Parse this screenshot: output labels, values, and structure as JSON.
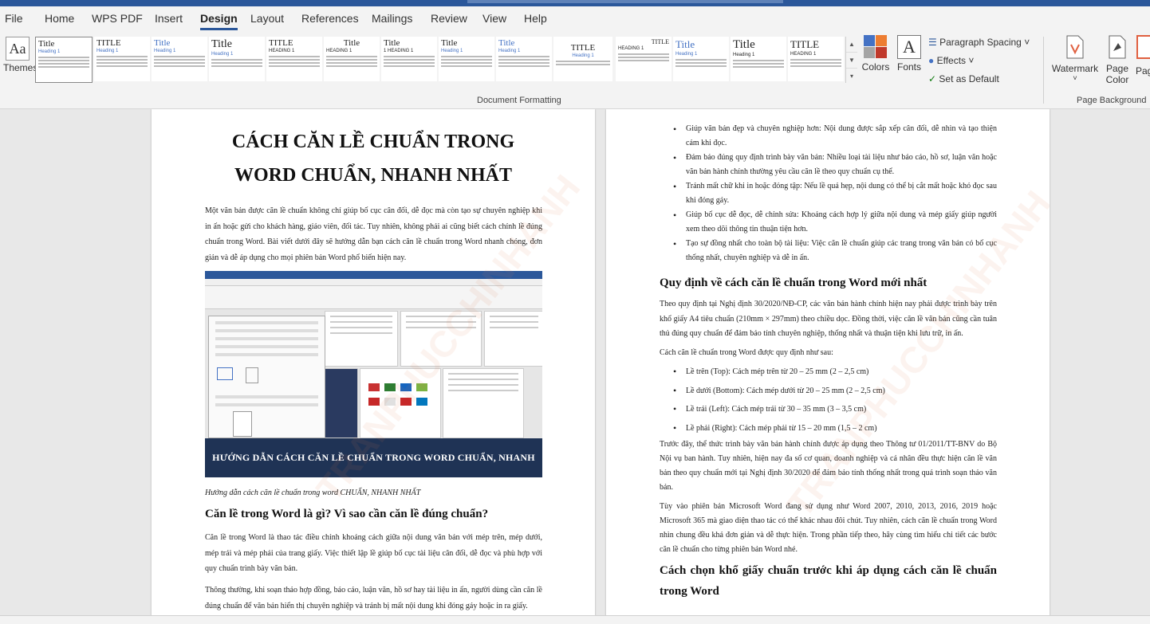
{
  "ribbon_tabs": [
    "File",
    "Home",
    "WPS PDF",
    "Insert",
    "Design",
    "Layout",
    "References",
    "Mailings",
    "Review",
    "View",
    "Help"
  ],
  "active_tab": "Design",
  "themes_label": "Themes",
  "style_gallery": [
    {
      "title": "Title",
      "heading": "Heading 1"
    },
    {
      "title": "TITLE",
      "heading": "Heading 1"
    },
    {
      "title": "Title",
      "heading": "Heading 1"
    },
    {
      "title": "Title",
      "heading": "Heading 1"
    },
    {
      "title": "TITLE",
      "heading": "HEADING 1"
    },
    {
      "title": "Title",
      "heading": "HEADING 1"
    },
    {
      "title": "Title",
      "heading": "1 HEADING 1"
    },
    {
      "title": "Title",
      "heading": "Heading 1"
    },
    {
      "title": "Title",
      "heading": "Heading 1"
    },
    {
      "title": "TITLE",
      "heading": "Heading 1"
    },
    {
      "title": "TITLE",
      "heading": "HEADING 1"
    },
    {
      "title": "Title",
      "heading": "Heading 1"
    },
    {
      "title": "Title",
      "heading": "Heading 1"
    },
    {
      "title": "TITLE",
      "heading": "HEADING 1"
    }
  ],
  "colors_label": "Colors",
  "fonts_label": "Fonts",
  "paragraph_spacing_label": "Paragraph Spacing",
  "effects_label": "Effects",
  "set_default_label": "Set as Default",
  "watermark_label": "Watermark",
  "page_color_label": "Page Color",
  "page_borders_label": "Page Bo",
  "document_formatting_label": "Document Formatting",
  "page_background_label": "Page Background",
  "page1": {
    "title_line1": "CÁCH CĂN LỀ CHUẨN TRONG",
    "title_line2": "WORD CHUẨN, NHANH NHẤT",
    "intro": "Một văn bản được căn lề chuẩn không chỉ giúp bố cục cân đối, dễ đọc mà còn tạo sự chuyên nghiệp khi in ấn hoặc gửi cho khách hàng, giáo viên, đối tác. Tuy nhiên, không phải ai cũng biết cách chỉnh lề đúng chuẩn trong Word. Bài viết dưới đây sẽ hướng dẫn bạn cách căn lề chuẩn trong Word nhanh chóng, đơn giản và dễ áp dụng cho mọi phiên bản Word phổ biến hiện nay.",
    "image_banner": "HƯỚNG DẪN CÁCH CĂN LỀ CHUẨN TRONG WORD CHUẨN, NHANH NHẤT",
    "caption": "Hướng dẫn cách căn lề chuẩn trong word CHUẨN, NHANH NHẤT",
    "heading2": "Căn lề trong Word là gì? Vì sao cần căn lề đúng chuẩn?",
    "para2": "Căn lề trong Word là thao tác điều chỉnh khoảng cách giữa nội dung văn bản với mép trên, mép dưới, mép trái và mép phải của trang giấy. Việc thiết lập lề giúp bố cục tài liệu cân đối, dễ đọc và phù hợp với quy chuẩn trình bày văn bản.",
    "para3": "Thông thường, khi soạn thảo hợp đồng, báo cáo, luận văn, hồ sơ hay tài liệu in ấn, người dùng cần căn lề đúng chuẩn để văn bản hiển thị chuyên nghiệp và tránh bị mất nội dung khi đóng gáy hoặc in ra giấy."
  },
  "page2": {
    "bullets1": [
      "Giúp văn bản đẹp và chuyên nghiệp hơn: Nội dung được sắp xếp cân đối, dễ nhìn và tạo thiện cảm khi đọc.",
      "Đảm bảo đúng quy định trình bày văn bản: Nhiều loại tài liệu như báo cáo, hồ sơ, luận văn hoặc văn bản hành chính thường yêu cầu căn lề theo quy chuẩn cụ thể.",
      "Tránh mất chữ khi in hoặc đóng tập: Nếu lề quá hẹp, nội dung có thể bị cắt mất hoặc khó đọc sau khi đóng gáy.",
      "Giúp bố cục dễ đọc, dễ chỉnh sửa: Khoảng cách hợp lý giữa nội dung và mép giấy giúp người xem theo dõi thông tin thuận tiện hơn.",
      "Tạo sự đồng nhất cho toàn bộ tài liệu: Việc căn lề chuẩn giúp các trang trong văn bản có bố cục thống nhất, chuyên nghiệp và dễ in ấn."
    ],
    "heading1": "Quy định về cách căn lề chuẩn trong Word mới nhất",
    "para1": "Theo quy định tại Nghị định 30/2020/NĐ-CP, các văn bản hành chính hiện nay phải được trình bày trên khổ giấy A4 tiêu chuẩn (210mm × 297mm) theo chiều dọc. Đồng thời, việc căn lề văn bản cũng cần tuân thủ đúng quy chuẩn để đảm bảo tính chuyên nghiệp, thống nhất và thuận tiện khi lưu trữ, in ấn.",
    "para2": "Cách căn lề chuẩn trong Word được quy định như sau:",
    "bullets2": [
      "Lề trên (Top): Cách mép trên từ 20 – 25 mm (2 – 2,5 cm)",
      "Lề dưới (Bottom): Cách mép dưới từ 20 – 25 mm (2 – 2,5 cm)",
      "Lề trái (Left): Cách mép trái từ 30 – 35 mm (3 – 3,5 cm)",
      "Lề phải (Right): Cách mép phải từ 15 – 20 mm (1,5 – 2 cm)"
    ],
    "para3": "Trước đây, thể thức trình bày văn bản hành chính được áp dụng theo Thông tư 01/2011/TT-BNV do Bộ Nội vụ ban hành. Tuy nhiên, hiện nay đa số cơ quan, doanh nghiệp và cá nhân đều thực hiện căn lề văn bản theo quy chuẩn mới tại Nghị định 30/2020 để đảm bảo tính thống nhất trong quá trình soạn thảo văn bản.",
    "para4": "Tùy vào phiên bản Microsoft Word đang sử dụng như Word 2007, 2010, 2013, 2016, 2019 hoặc Microsoft 365 mà giao diện thao tác có thể khác nhau đôi chút. Tuy nhiên, cách căn lề chuẩn trong Word nhìn chung đều khá đơn giản và dễ thực hiện. Trong phần tiếp theo, hãy cùng tìm hiểu chi tiết các bước căn lề chuẩn cho từng phiên bản Word nhé.",
    "heading2": "Cách chọn khổ giấy chuẩn trước khi áp dụng cách căn lề chuẩn trong Word"
  },
  "colors": {
    "accent": "#2b579a",
    "banner": "#1f3355",
    "link_heading": "#4472c4"
  }
}
